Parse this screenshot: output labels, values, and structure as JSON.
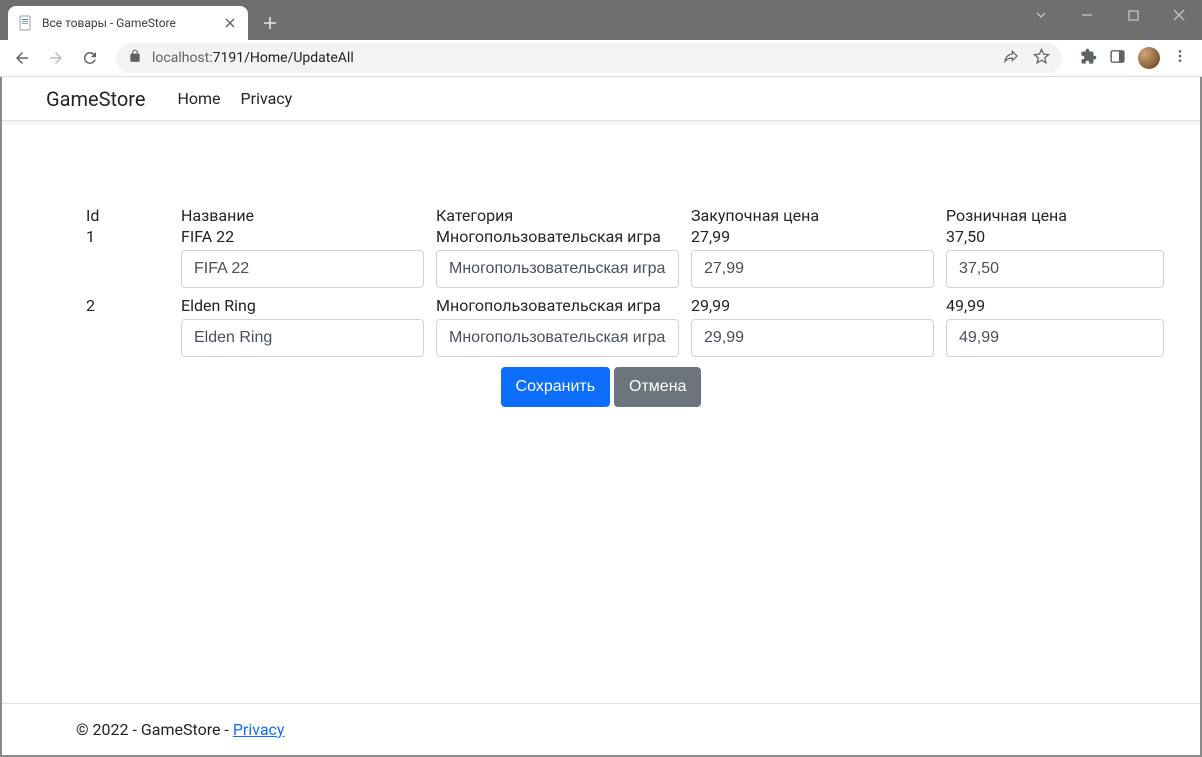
{
  "browser": {
    "tab_title": "Все товары - GameStore",
    "url_host": "localhost:",
    "url_port_path": "7191/Home/UpdateAll"
  },
  "navbar": {
    "brand": "GameStore",
    "links": {
      "home": "Home",
      "privacy": "Privacy"
    }
  },
  "table": {
    "headers": {
      "id": "Id",
      "name": "Название",
      "category": "Категория",
      "purchase_price": "Закупочная цена",
      "retail_price": "Розничная цена"
    },
    "rows": [
      {
        "id": "1",
        "name": "FIFA 22",
        "category": "Многопользовательская игра",
        "purchase_price": "27,99",
        "retail_price": "37,50",
        "inputs": {
          "name": "FIFA 22",
          "category": "Многопользовательская игра",
          "purchase_price": "27,99",
          "retail_price": "37,50"
        }
      },
      {
        "id": "2",
        "name": "Elden Ring",
        "category": "Многопользовательская игра",
        "purchase_price": "29,99",
        "retail_price": "49,99",
        "inputs": {
          "name": "Elden Ring",
          "category": "Многопользовательская игра",
          "purchase_price": "29,99",
          "retail_price": "49,99"
        }
      }
    ]
  },
  "buttons": {
    "save": "Сохранить",
    "cancel": "Отмена"
  },
  "footer": {
    "copyright": "© 2022 - GameStore - ",
    "privacy": "Privacy"
  }
}
